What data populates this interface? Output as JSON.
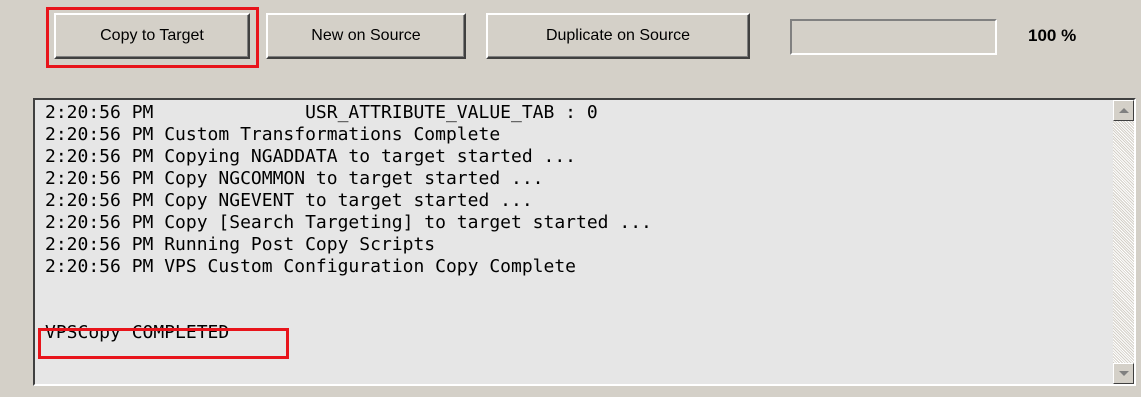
{
  "toolbar": {
    "copy_to_target_label": "Copy to Target",
    "new_on_source_label": "New on Source",
    "duplicate_on_source_label": "Duplicate on Source"
  },
  "progress": {
    "value_percent": 100,
    "label": "100 %"
  },
  "log": {
    "lines": [
      "2:20:56 PM              USR_ATTRIBUTE_VALUE_TAB : 0",
      "2:20:56 PM Custom Transformations Complete",
      "2:20:56 PM Copying NGADDATA to target started ...",
      "2:20:56 PM Copy NGCOMMON to target started ...",
      "2:20:56 PM Copy NGEVENT to target started ...",
      "2:20:56 PM Copy [Search Targeting] to target started ...",
      "2:20:56 PM Running Post Copy Scripts",
      "2:20:56 PM VPS Custom Configuration Copy Complete",
      "",
      "",
      "VPSCopy COMPLETED"
    ]
  },
  "colors": {
    "window_bg": "#d4d0c8",
    "highlight": "#e8141b",
    "log_bg": "#e6e6e6"
  },
  "icons": {
    "scroll_up": "triangle-up-icon",
    "scroll_down": "triangle-down-icon"
  }
}
